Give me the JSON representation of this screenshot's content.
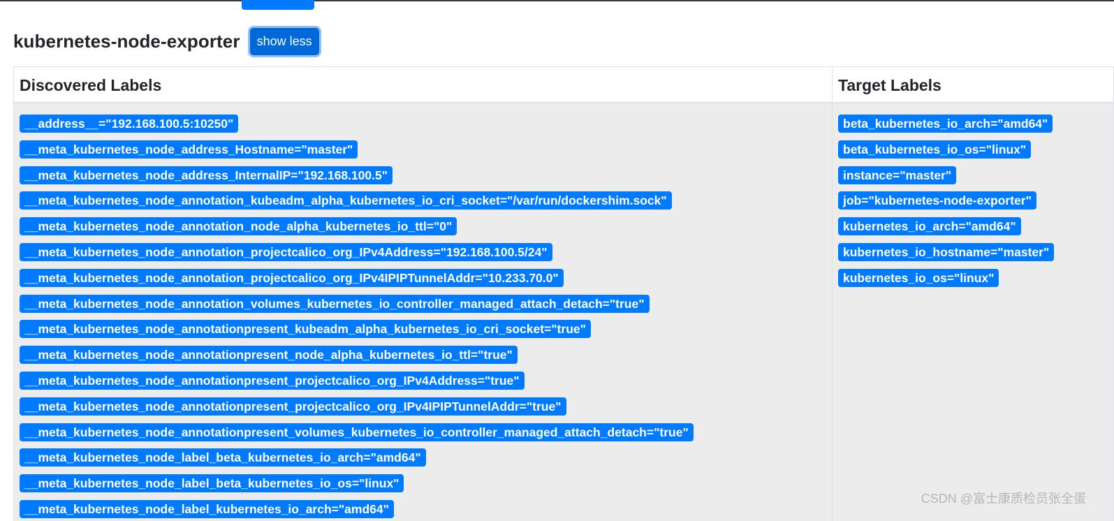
{
  "section": {
    "title": "kubernetes-node-exporter",
    "toggle_label": "show less"
  },
  "table": {
    "headers": {
      "discovered": "Discovered Labels",
      "target": "Target Labels"
    },
    "discovered_labels": [
      "__address__=\"192.168.100.5:10250\"",
      "__meta_kubernetes_node_address_Hostname=\"master\"",
      "__meta_kubernetes_node_address_InternalIP=\"192.168.100.5\"",
      "__meta_kubernetes_node_annotation_kubeadm_alpha_kubernetes_io_cri_socket=\"/var/run/dockershim.sock\"",
      "__meta_kubernetes_node_annotation_node_alpha_kubernetes_io_ttl=\"0\"",
      "__meta_kubernetes_node_annotation_projectcalico_org_IPv4Address=\"192.168.100.5/24\"",
      "__meta_kubernetes_node_annotation_projectcalico_org_IPv4IPIPTunnelAddr=\"10.233.70.0\"",
      "__meta_kubernetes_node_annotation_volumes_kubernetes_io_controller_managed_attach_detach=\"true\"",
      "__meta_kubernetes_node_annotationpresent_kubeadm_alpha_kubernetes_io_cri_socket=\"true\"",
      "__meta_kubernetes_node_annotationpresent_node_alpha_kubernetes_io_ttl=\"true\"",
      "__meta_kubernetes_node_annotationpresent_projectcalico_org_IPv4Address=\"true\"",
      "__meta_kubernetes_node_annotationpresent_projectcalico_org_IPv4IPIPTunnelAddr=\"true\"",
      "__meta_kubernetes_node_annotationpresent_volumes_kubernetes_io_controller_managed_attach_detach=\"true\"",
      "__meta_kubernetes_node_label_beta_kubernetes_io_arch=\"amd64\"",
      "__meta_kubernetes_node_label_beta_kubernetes_io_os=\"linux\"",
      "__meta_kubernetes_node_label_kubernetes_io_arch=\"amd64\""
    ],
    "target_labels": [
      "beta_kubernetes_io_arch=\"amd64\"",
      "beta_kubernetes_io_os=\"linux\"",
      "instance=\"master\"",
      "job=\"kubernetes-node-exporter\"",
      "kubernetes_io_arch=\"amd64\"",
      "kubernetes_io_hostname=\"master\"",
      "kubernetes_io_os=\"linux\""
    ]
  },
  "watermark": "CSDN @富士康质检员张全蛋",
  "colors": {
    "badge": "#007bff",
    "button": "#0069d9",
    "cell_background": "#ececec"
  }
}
